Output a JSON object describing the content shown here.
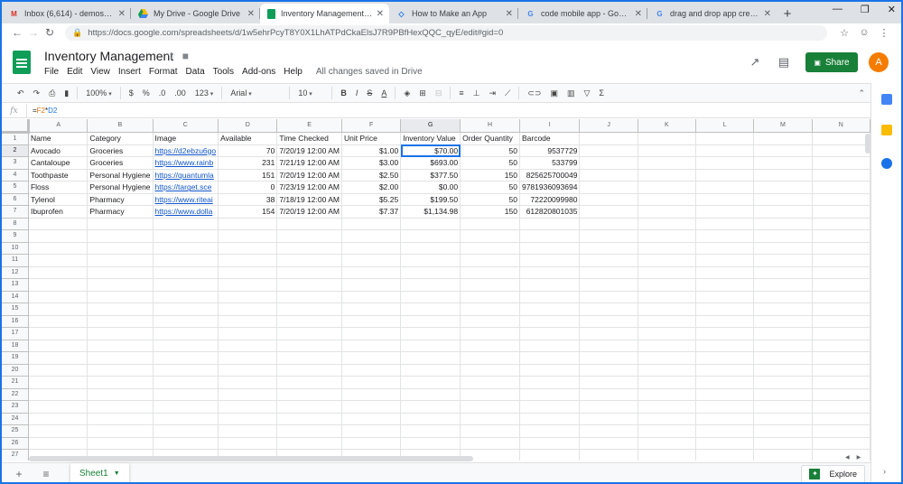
{
  "browser": {
    "tabs": [
      {
        "title": "Inbox (6,614) - demos@1track",
        "icon": "gmail-icon",
        "active": false
      },
      {
        "title": "My Drive - Google Drive",
        "icon": "drive-icon",
        "active": false
      },
      {
        "title": "Inventory Management - Go",
        "icon": "sheets-icon",
        "active": true
      },
      {
        "title": "How to Make an App",
        "icon": "appsheet-icon",
        "active": false
      },
      {
        "title": "code mobile app - Google Se",
        "icon": "google-icon",
        "active": false
      },
      {
        "title": "drag and drop app creator -",
        "icon": "google-icon",
        "active": false
      }
    ],
    "new_tab": "+",
    "url": "https://docs.google.com/spreadsheets/d/1w5ehrPcyT8Y0X1LhATPdCkaElsJ7R9PBfHexQQC_qyE/edit#gid=0"
  },
  "doc": {
    "title": "Inventory Management",
    "menus": [
      "File",
      "Edit",
      "View",
      "Insert",
      "Format",
      "Data",
      "Tools",
      "Add-ons",
      "Help"
    ],
    "save_status": "All changes saved in Drive",
    "share_label": "Share",
    "avatar_letter": "A"
  },
  "toolbar": {
    "zoom": "100%",
    "currency": "$",
    "percent": "%",
    "dec_less": ".0",
    "dec_more": ".00",
    "more_formats": "123",
    "font": "Arial",
    "font_size": "10",
    "bold": "B",
    "italic": "I",
    "strike": "S",
    "text_color": "A",
    "sum": "Σ"
  },
  "formula_bar": {
    "fx": "fx",
    "eq": "=",
    "ref1": "F2",
    "op": "*",
    "ref2": "D2"
  },
  "grid": {
    "columns": [
      "A",
      "B",
      "C",
      "D",
      "E",
      "F",
      "G",
      "H",
      "I",
      "J",
      "K",
      "L",
      "M",
      "N"
    ],
    "selected_column": "G",
    "selected_row": 2,
    "total_rows": 27,
    "rows": [
      [
        "Name",
        "Category",
        "Image",
        "Available",
        "Time Checked",
        "Unit Price",
        "Inventory Value",
        "Order Quantity",
        "Barcode"
      ],
      [
        "Avocado",
        "Groceries",
        "https://d2ebzu6go",
        "70",
        "7/20/19 12:00 AM",
        "$1.00",
        "$70.00",
        "50",
        "9537729"
      ],
      [
        "Cantaloupe",
        "Groceries",
        "https://www.rainb",
        "231",
        "7/21/19 12:00 AM",
        "$3.00",
        "$693.00",
        "50",
        "533799"
      ],
      [
        "Toothpaste",
        "Personal Hygiene",
        "https://quantumla",
        "151",
        "7/20/19 12:00 AM",
        "$2.50",
        "$377.50",
        "150",
        "825625700049"
      ],
      [
        "Floss",
        "Personal Hygiene",
        "https://target.sce",
        "0",
        "7/23/19 12:00 AM",
        "$2.00",
        "$0.00",
        "50",
        "9781936093694"
      ],
      [
        "Tylenol",
        "Pharmacy",
        "https://www.riteai",
        "38",
        "7/18/19 12:00 AM",
        "$5.25",
        "$199.50",
        "50",
        "72220099980"
      ],
      [
        "Ibuprofen",
        "Pharmacy",
        "https://www.dolla",
        "154",
        "7/20/19 12:00 AM",
        "$7.37",
        "$1,134.98",
        "150",
        "612820801035"
      ]
    ]
  },
  "bottom": {
    "sheet_name": "Sheet1",
    "explore_label": "Explore"
  },
  "colors": {
    "sheets_green": "#188038",
    "selection_blue": "#1a73e8",
    "link_blue": "#1155cc"
  }
}
